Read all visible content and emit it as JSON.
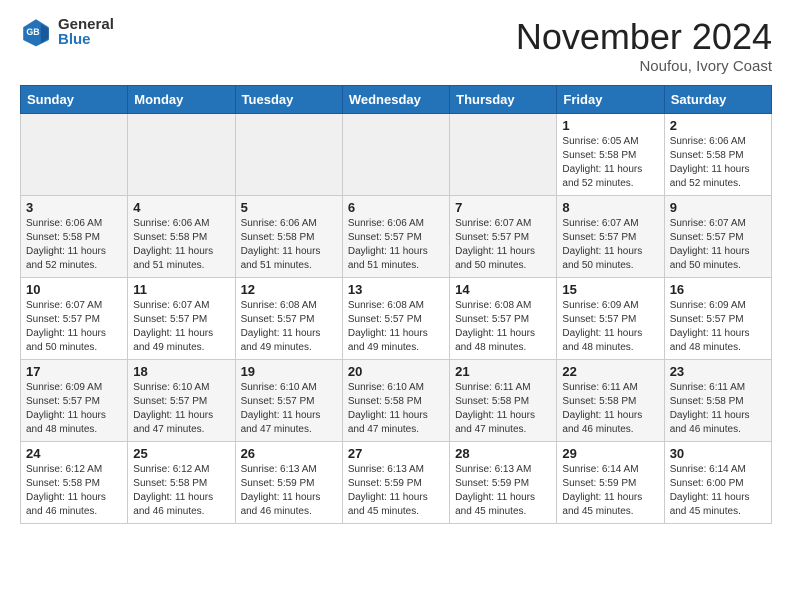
{
  "header": {
    "logo_general": "General",
    "logo_blue": "Blue",
    "month_title": "November 2024",
    "location": "Noufou, Ivory Coast"
  },
  "days_of_week": [
    "Sunday",
    "Monday",
    "Tuesday",
    "Wednesday",
    "Thursday",
    "Friday",
    "Saturday"
  ],
  "weeks": [
    [
      {
        "day": "",
        "text": ""
      },
      {
        "day": "",
        "text": ""
      },
      {
        "day": "",
        "text": ""
      },
      {
        "day": "",
        "text": ""
      },
      {
        "day": "",
        "text": ""
      },
      {
        "day": "1",
        "text": "Sunrise: 6:05 AM\nSunset: 5:58 PM\nDaylight: 11 hours and 52 minutes."
      },
      {
        "day": "2",
        "text": "Sunrise: 6:06 AM\nSunset: 5:58 PM\nDaylight: 11 hours and 52 minutes."
      }
    ],
    [
      {
        "day": "3",
        "text": "Sunrise: 6:06 AM\nSunset: 5:58 PM\nDaylight: 11 hours and 52 minutes."
      },
      {
        "day": "4",
        "text": "Sunrise: 6:06 AM\nSunset: 5:58 PM\nDaylight: 11 hours and 51 minutes."
      },
      {
        "day": "5",
        "text": "Sunrise: 6:06 AM\nSunset: 5:58 PM\nDaylight: 11 hours and 51 minutes."
      },
      {
        "day": "6",
        "text": "Sunrise: 6:06 AM\nSunset: 5:57 PM\nDaylight: 11 hours and 51 minutes."
      },
      {
        "day": "7",
        "text": "Sunrise: 6:07 AM\nSunset: 5:57 PM\nDaylight: 11 hours and 50 minutes."
      },
      {
        "day": "8",
        "text": "Sunrise: 6:07 AM\nSunset: 5:57 PM\nDaylight: 11 hours and 50 minutes."
      },
      {
        "day": "9",
        "text": "Sunrise: 6:07 AM\nSunset: 5:57 PM\nDaylight: 11 hours and 50 minutes."
      }
    ],
    [
      {
        "day": "10",
        "text": "Sunrise: 6:07 AM\nSunset: 5:57 PM\nDaylight: 11 hours and 50 minutes."
      },
      {
        "day": "11",
        "text": "Sunrise: 6:07 AM\nSunset: 5:57 PM\nDaylight: 11 hours and 49 minutes."
      },
      {
        "day": "12",
        "text": "Sunrise: 6:08 AM\nSunset: 5:57 PM\nDaylight: 11 hours and 49 minutes."
      },
      {
        "day": "13",
        "text": "Sunrise: 6:08 AM\nSunset: 5:57 PM\nDaylight: 11 hours and 49 minutes."
      },
      {
        "day": "14",
        "text": "Sunrise: 6:08 AM\nSunset: 5:57 PM\nDaylight: 11 hours and 48 minutes."
      },
      {
        "day": "15",
        "text": "Sunrise: 6:09 AM\nSunset: 5:57 PM\nDaylight: 11 hours and 48 minutes."
      },
      {
        "day": "16",
        "text": "Sunrise: 6:09 AM\nSunset: 5:57 PM\nDaylight: 11 hours and 48 minutes."
      }
    ],
    [
      {
        "day": "17",
        "text": "Sunrise: 6:09 AM\nSunset: 5:57 PM\nDaylight: 11 hours and 48 minutes."
      },
      {
        "day": "18",
        "text": "Sunrise: 6:10 AM\nSunset: 5:57 PM\nDaylight: 11 hours and 47 minutes."
      },
      {
        "day": "19",
        "text": "Sunrise: 6:10 AM\nSunset: 5:57 PM\nDaylight: 11 hours and 47 minutes."
      },
      {
        "day": "20",
        "text": "Sunrise: 6:10 AM\nSunset: 5:58 PM\nDaylight: 11 hours and 47 minutes."
      },
      {
        "day": "21",
        "text": "Sunrise: 6:11 AM\nSunset: 5:58 PM\nDaylight: 11 hours and 47 minutes."
      },
      {
        "day": "22",
        "text": "Sunrise: 6:11 AM\nSunset: 5:58 PM\nDaylight: 11 hours and 46 minutes."
      },
      {
        "day": "23",
        "text": "Sunrise: 6:11 AM\nSunset: 5:58 PM\nDaylight: 11 hours and 46 minutes."
      }
    ],
    [
      {
        "day": "24",
        "text": "Sunrise: 6:12 AM\nSunset: 5:58 PM\nDaylight: 11 hours and 46 minutes."
      },
      {
        "day": "25",
        "text": "Sunrise: 6:12 AM\nSunset: 5:58 PM\nDaylight: 11 hours and 46 minutes."
      },
      {
        "day": "26",
        "text": "Sunrise: 6:13 AM\nSunset: 5:59 PM\nDaylight: 11 hours and 46 minutes."
      },
      {
        "day": "27",
        "text": "Sunrise: 6:13 AM\nSunset: 5:59 PM\nDaylight: 11 hours and 45 minutes."
      },
      {
        "day": "28",
        "text": "Sunrise: 6:13 AM\nSunset: 5:59 PM\nDaylight: 11 hours and 45 minutes."
      },
      {
        "day": "29",
        "text": "Sunrise: 6:14 AM\nSunset: 5:59 PM\nDaylight: 11 hours and 45 minutes."
      },
      {
        "day": "30",
        "text": "Sunrise: 6:14 AM\nSunset: 6:00 PM\nDaylight: 11 hours and 45 minutes."
      }
    ]
  ]
}
